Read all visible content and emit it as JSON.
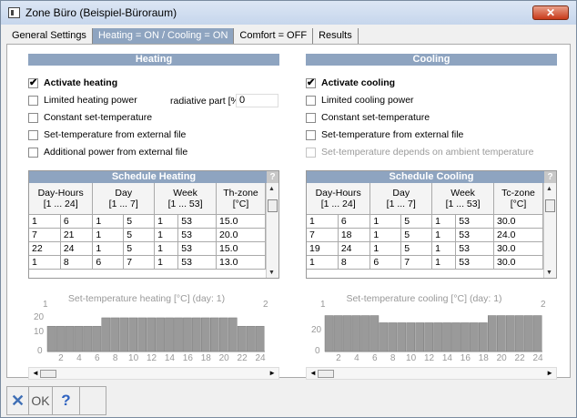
{
  "window": {
    "title": "Zone Büro  (Beispiel-Büroraum)",
    "close_label": "✕"
  },
  "tabs": [
    {
      "label": "General Settings",
      "active": false
    },
    {
      "label": "Heating = ON / Cooling = ON",
      "active": true
    },
    {
      "label": "Comfort = OFF",
      "active": false
    },
    {
      "label": "Results",
      "active": false
    }
  ],
  "heating": {
    "header": "Heating",
    "activate": {
      "label": "Activate heating",
      "checked": true
    },
    "limited": {
      "label": "Limited heating power",
      "checked": false
    },
    "radiative_label": "radiative part [%]",
    "radiative_value": "0",
    "constant": {
      "label": "Constant set-temperature",
      "checked": false
    },
    "from_file": {
      "label": "Set-temperature from external file",
      "checked": false
    },
    "additional": {
      "label": "Additional power from external file",
      "checked": false
    },
    "schedule": {
      "title": "Schedule Heating",
      "help": "?",
      "columns": [
        {
          "l1": "Day-Hours",
          "l2": "[1 ... 24]"
        },
        {
          "l1": "Day",
          "l2": "[1 ... 7]"
        },
        {
          "l1": "Week",
          "l2": "[1 ... 53]"
        },
        {
          "l1": "Th-zone",
          "l2": "[°C]"
        }
      ],
      "rows": [
        [
          "1",
          "6",
          "1",
          "5",
          "1",
          "53",
          "15.0"
        ],
        [
          "7",
          "21",
          "1",
          "5",
          "1",
          "53",
          "20.0"
        ],
        [
          "22",
          "24",
          "1",
          "5",
          "1",
          "53",
          "15.0"
        ],
        [
          "1",
          "8",
          "6",
          "7",
          "1",
          "53",
          "13.0"
        ]
      ]
    },
    "chart": {
      "title": "Set-temperature heating [°C]  (day: 1)",
      "left_top": "1",
      "right_top": "2",
      "y_ticks": [
        "20",
        "10",
        "0"
      ],
      "x_ticks": [
        "2",
        "4",
        "6",
        "8",
        "10",
        "12",
        "14",
        "16",
        "18",
        "20",
        "22",
        "24"
      ]
    }
  },
  "cooling": {
    "header": "Cooling",
    "activate": {
      "label": "Activate cooling",
      "checked": true
    },
    "limited": {
      "label": "Limited cooling power",
      "checked": false
    },
    "constant": {
      "label": "Constant set-temperature",
      "checked": false
    },
    "from_file": {
      "label": "Set-temperature from external file",
      "checked": false
    },
    "ambient": {
      "label": "Set-temperature depends on ambient temperature",
      "checked": false,
      "disabled": true
    },
    "schedule": {
      "title": "Schedule Cooling",
      "help": "?",
      "columns": [
        {
          "l1": "Day-Hours",
          "l2": "[1 ... 24]"
        },
        {
          "l1": "Day",
          "l2": "[1 ... 7]"
        },
        {
          "l1": "Week",
          "l2": "[1 ... 53]"
        },
        {
          "l1": "Tc-zone",
          "l2": "[°C]"
        }
      ],
      "rows": [
        [
          "1",
          "6",
          "1",
          "5",
          "1",
          "53",
          "30.0"
        ],
        [
          "7",
          "18",
          "1",
          "5",
          "1",
          "53",
          "24.0"
        ],
        [
          "19",
          "24",
          "1",
          "5",
          "1",
          "53",
          "30.0"
        ],
        [
          "1",
          "8",
          "6",
          "7",
          "1",
          "53",
          "30.0"
        ]
      ]
    },
    "chart": {
      "title": "Set-temperature cooling [°C]  (day: 1)",
      "left_top": "1",
      "right_top": "2",
      "y_ticks": [
        "20",
        "0"
      ],
      "x_ticks": [
        "2",
        "4",
        "6",
        "8",
        "10",
        "12",
        "14",
        "16",
        "18",
        "20",
        "22",
        "24"
      ]
    }
  },
  "chart_data": [
    {
      "type": "bar",
      "title": "Set-temperature heating [°C]  (day: 1)",
      "categories": [
        "1",
        "2",
        "3",
        "4",
        "5",
        "6",
        "7",
        "8",
        "9",
        "10",
        "11",
        "12",
        "13",
        "14",
        "15",
        "16",
        "17",
        "18",
        "19",
        "20",
        "21",
        "22",
        "23",
        "24"
      ],
      "values": [
        15,
        15,
        15,
        15,
        15,
        15,
        20,
        20,
        20,
        20,
        20,
        20,
        20,
        20,
        20,
        20,
        20,
        20,
        20,
        20,
        20,
        15,
        15,
        15
      ],
      "ylim": [
        0,
        27
      ]
    },
    {
      "type": "bar",
      "title": "Set-temperature cooling [°C]  (day: 1)",
      "categories": [
        "1",
        "2",
        "3",
        "4",
        "5",
        "6",
        "7",
        "8",
        "9",
        "10",
        "11",
        "12",
        "13",
        "14",
        "15",
        "16",
        "17",
        "18",
        "19",
        "20",
        "21",
        "22",
        "23",
        "24"
      ],
      "values": [
        30,
        30,
        30,
        30,
        30,
        30,
        24,
        24,
        24,
        24,
        24,
        24,
        24,
        24,
        24,
        24,
        24,
        24,
        30,
        30,
        30,
        30,
        30,
        30
      ],
      "ylim": [
        0,
        38
      ]
    }
  ],
  "buttons": {
    "cancel": "✕",
    "ok": "OK",
    "help": "?"
  }
}
